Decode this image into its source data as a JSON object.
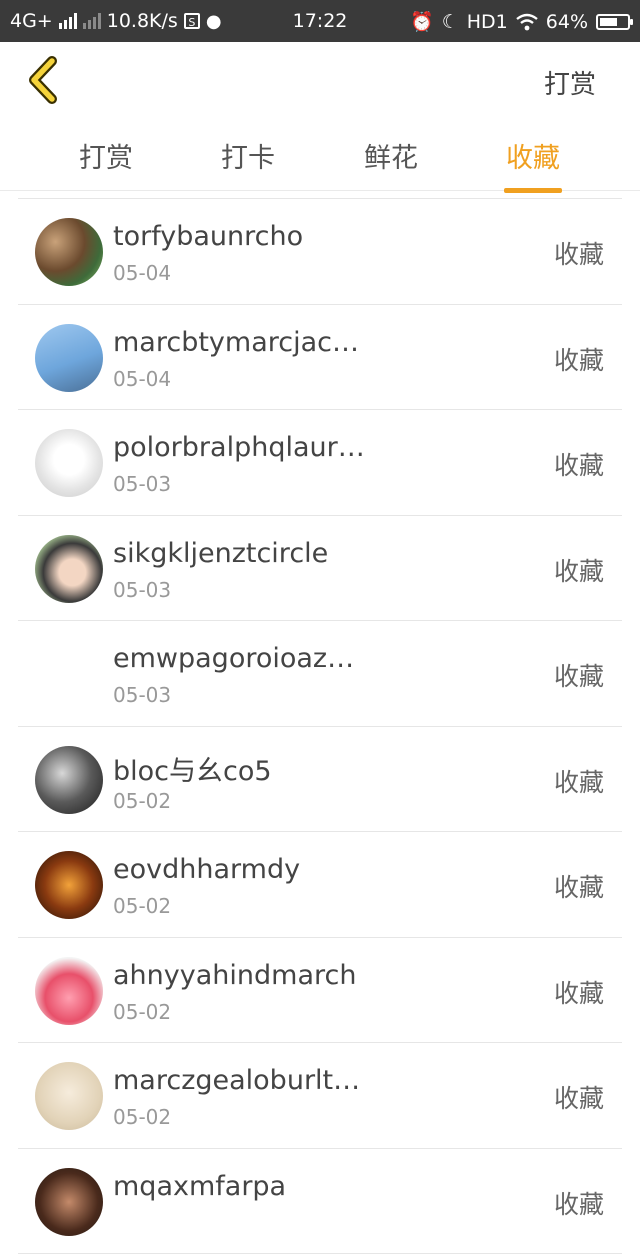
{
  "status_bar": {
    "network": "4G+",
    "speed": "10.8K/s",
    "time": "17:22",
    "hd": "HD1",
    "battery": "64%",
    "battery_level": 0.64
  },
  "nav": {
    "back_icon": "chevron-left-icon",
    "action_label": "打赏"
  },
  "tabs": [
    {
      "label": "打赏",
      "active": false
    },
    {
      "label": "打卡",
      "active": false
    },
    {
      "label": "鲜花",
      "active": false
    },
    {
      "label": "收藏",
      "active": true
    }
  ],
  "accent_color": "#f0a020",
  "rows": [
    {
      "name": "torfybaunrcho",
      "date": "05-04",
      "tag": "收藏",
      "avatar": "photo"
    },
    {
      "name": "marcbtymarcjac…",
      "date": "05-04",
      "tag": "收藏",
      "avatar": "photo"
    },
    {
      "name": "polorbralphqlaur…",
      "date": "05-03",
      "tag": "收藏",
      "avatar": "sketch"
    },
    {
      "name": "sikgkljenztcircle",
      "date": "05-03",
      "tag": "收藏",
      "avatar": "photo"
    },
    {
      "name": "emwpagoroioaz…",
      "date": "05-03",
      "tag": "收藏",
      "avatar": "none"
    },
    {
      "name": "bloc与幺co5",
      "date": "05-02",
      "tag": "收藏",
      "avatar": "photo"
    },
    {
      "name": "eovdhharmdy",
      "date": "05-02",
      "tag": "收藏",
      "avatar": "photo"
    },
    {
      "name": "ahnyyahindmarch",
      "date": "05-02",
      "tag": "收藏",
      "avatar": "photo"
    },
    {
      "name": "marczgealoburlt…",
      "date": "05-02",
      "tag": "收藏",
      "avatar": "photo"
    },
    {
      "name": "mqaxmfarpa",
      "date": "",
      "tag": "收藏",
      "avatar": "photo"
    }
  ]
}
